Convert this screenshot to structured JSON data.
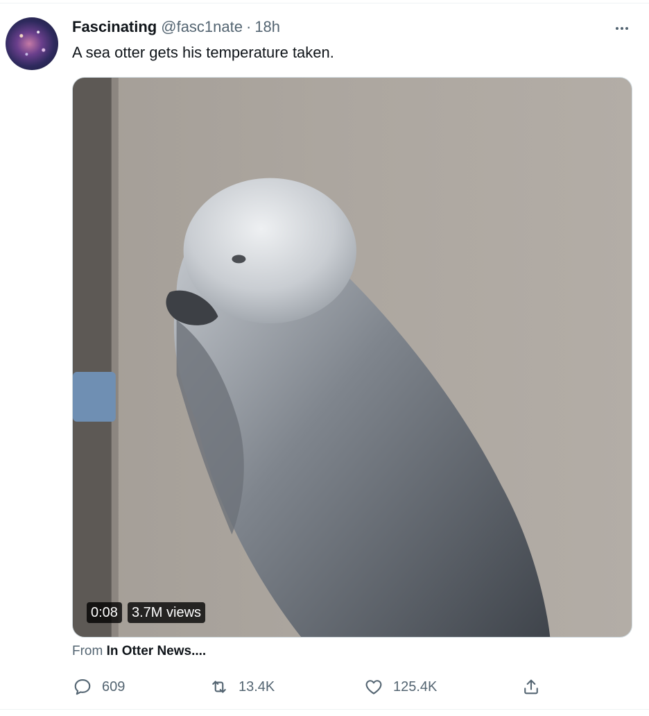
{
  "tweet": {
    "author_name": "Fascinating",
    "author_handle": "@fasc1nate",
    "separator": "·",
    "timestamp": "18h",
    "text": "A sea otter gets his temperature taken."
  },
  "media": {
    "duration": "0:08",
    "views": "3.7M views"
  },
  "source": {
    "prefix": "From",
    "name": "In Otter News...."
  },
  "actions": {
    "reply_count": "609",
    "retweet_count": "13.4K",
    "like_count": "125.4K"
  },
  "icons": {
    "more": "more-horizontal-icon",
    "reply": "reply-bubble-icon",
    "retweet": "retweet-icon",
    "like": "heart-icon",
    "share": "share-upload-icon"
  },
  "colors": {
    "text_primary": "#0f1419",
    "text_secondary": "#536471",
    "divider": "#eff3f4",
    "media_border": "#cfd9de"
  }
}
